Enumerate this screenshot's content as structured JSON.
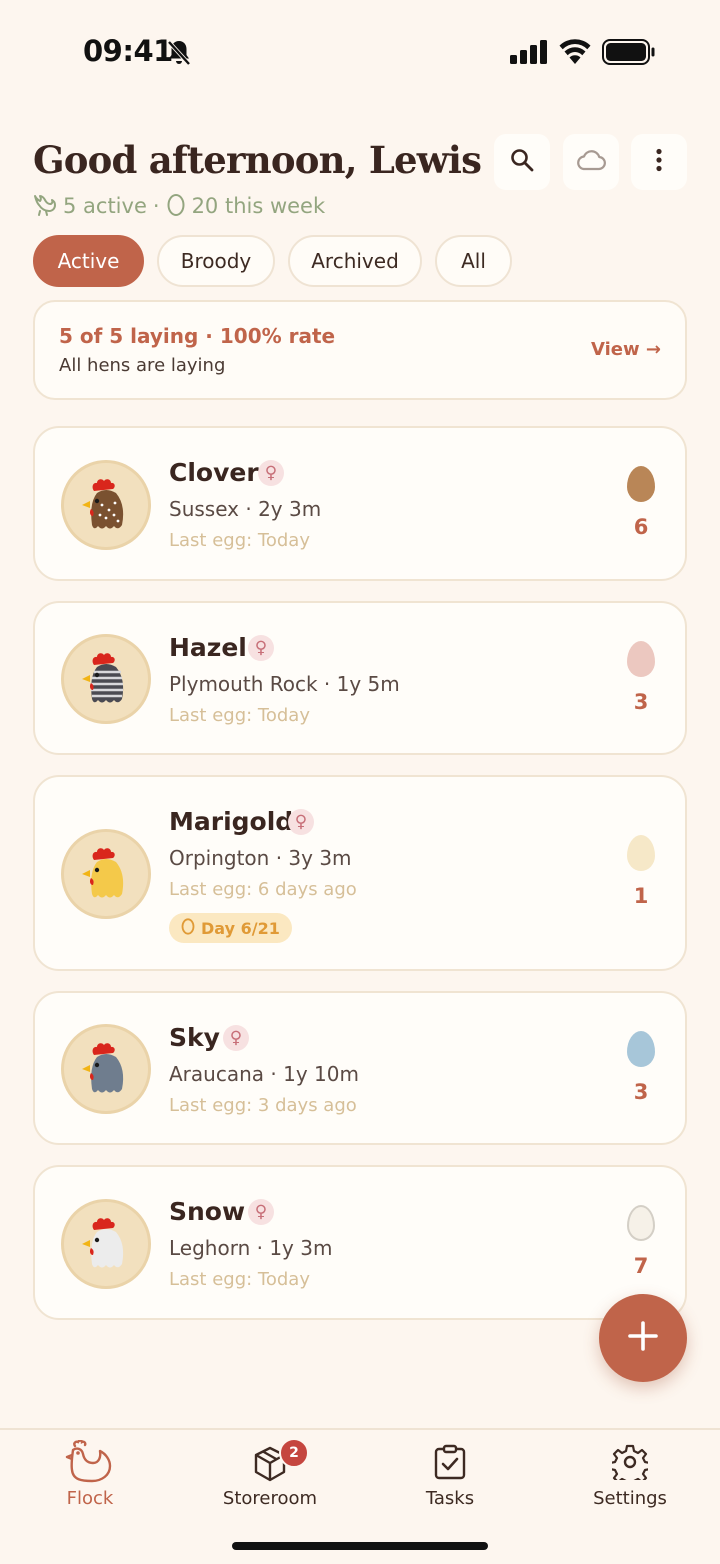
{
  "status_bar": {
    "time": "09:41"
  },
  "header": {
    "greeting": "Good afternoon, Lewis",
    "active_count": "5 active",
    "separator": "·",
    "week_count": "20 this week",
    "icons": [
      "search-icon",
      "cloud-icon",
      "more-vertical-icon"
    ]
  },
  "filters": [
    "Active",
    "Broody",
    "Archived",
    "All"
  ],
  "summary": {
    "title": "5 of 5 laying · 100% rate",
    "subtitle": "All hens are laying",
    "link": "View →"
  },
  "hens": [
    {
      "name": "Clover",
      "sex": "♀",
      "breed": "Sussex · 2y 3m",
      "last_egg": "Last egg: Today",
      "egg_count": "6",
      "egg_color": "#b98657"
    },
    {
      "name": "Hazel",
      "sex": "♀",
      "breed": "Plymouth Rock · 1y 5m",
      "last_egg": "Last egg: Today",
      "egg_count": "3",
      "egg_color": "#ecc8c0"
    },
    {
      "name": "Marigold",
      "sex": "♀",
      "breed": "Orpington · 3y 3m",
      "last_egg": "Last egg: 6 days ago",
      "egg_count": "1",
      "egg_color": "#f6e8c8",
      "broody_badge": "Day 6/21"
    },
    {
      "name": "Sky",
      "sex": "♀",
      "breed": "Araucana · 1y 10m",
      "last_egg": "Last egg: 3 days ago",
      "egg_count": "3",
      "egg_color": "#a7c6d9"
    },
    {
      "name": "Snow",
      "sex": "♀",
      "breed": "Leghorn · 1y 3m",
      "last_egg": "Last egg: Today",
      "egg_count": "7",
      "egg_color": "#f6f1e8"
    }
  ],
  "nav": {
    "items": [
      "Flock",
      "Storeroom",
      "Tasks",
      "Settings"
    ],
    "storeroom_badge": "2"
  },
  "colors": {
    "accent": "#c0644a",
    "background": "#fdf6ef",
    "muted_green": "#93a57f"
  }
}
